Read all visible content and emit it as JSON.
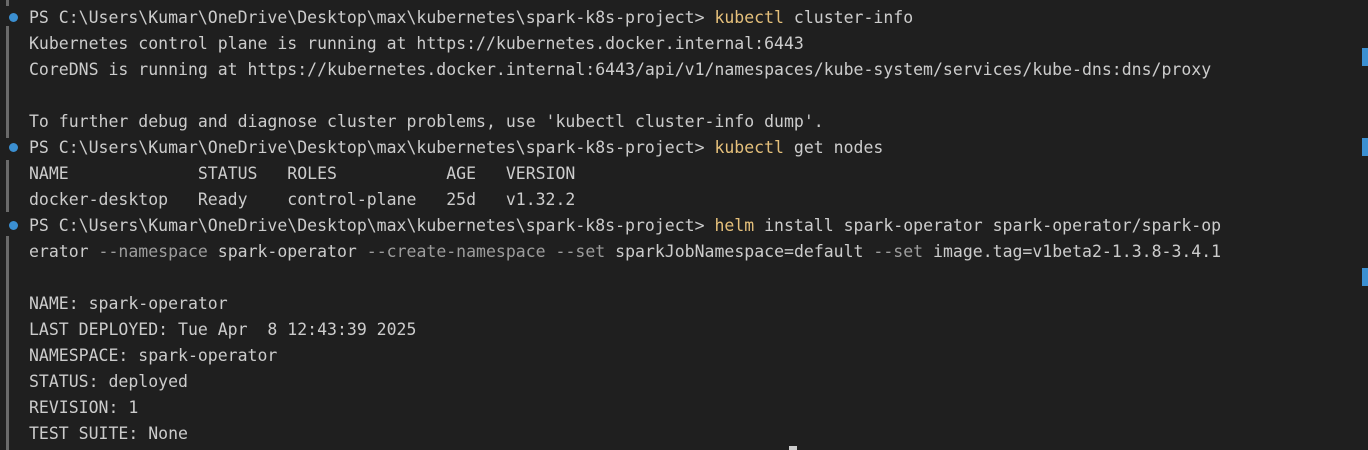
{
  "prompt": "PS C:\\Users\\Kumar\\OneDrive\\Desktop\\max\\kubernetes\\spark-k8s-project> ",
  "block1": {
    "cmd": "kubectl",
    "args": " cluster-info",
    "out1": "Kubernetes control plane is running at https://kubernetes.docker.internal:6443",
    "out2": "CoreDNS is running at https://kubernetes.docker.internal:6443/api/v1/namespaces/kube-system/services/kube-dns:dns/proxy",
    "out3": "To further debug and diagnose cluster problems, use 'kubectl cluster-info dump'."
  },
  "block2": {
    "cmd": "kubectl",
    "args": " get nodes",
    "header": "NAME             STATUS   ROLES           AGE   VERSION",
    "row": "docker-desktop   Ready    control-plane   25d   v1.32.2"
  },
  "block3": {
    "cmd": "helm",
    "args1": " install spark-operator spark-operator/spark-op",
    "w1": "erator ",
    "f1": "--namespace",
    "w2": " spark-operator ",
    "f2": "--create-namespace",
    "w3": " ",
    "f3": "--set",
    "w4": " sparkJobNamespace=default ",
    "f4": "--set",
    "w5": " image.tag=v1beta2-1.3.8-3.4.1",
    "out": [
      "NAME: spark-operator",
      "LAST DEPLOYED: Tue Apr  8 12:43:39 2025",
      "NAMESPACE: spark-operator",
      "STATUS: deployed",
      "REVISION: 1",
      "TEST SUITE: None"
    ]
  }
}
